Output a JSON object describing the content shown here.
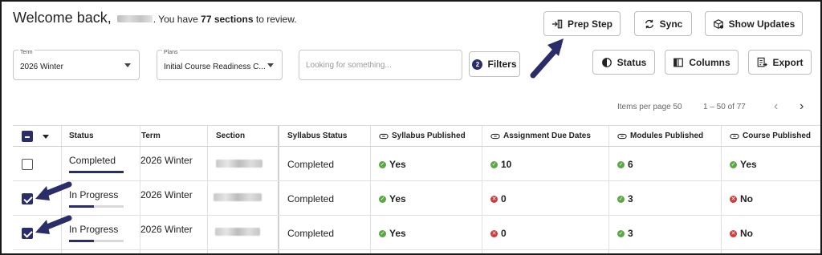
{
  "header": {
    "welcome_prefix": "Welcome back,",
    "welcome_suffix": ". You have",
    "count_text": "77 sections",
    "suffix2": "to review."
  },
  "toolbar": {
    "prep_step": "Prep Step",
    "sync": "Sync",
    "show_updates": "Show Updates",
    "status": "Status",
    "columns": "Columns",
    "export": "Export",
    "filters": "Filters",
    "filters_count": "2"
  },
  "filters": {
    "term_label": "Term",
    "term_value": "2026 Winter",
    "plans_label": "Plans",
    "plans_value": "Initial Course Readiness C...",
    "search_placeholder": "Looking for something..."
  },
  "pager": {
    "items_per_page": "Items per page 50",
    "range": "1 – 50 of 77"
  },
  "table": {
    "headers": {
      "status": "Status",
      "term": "Term",
      "section": "Section",
      "syllabus_status": "Syllabus Status",
      "syllabus_published": "Syllabus Published",
      "assignment_due_dates": "Assignment Due Dates",
      "modules_published": "Modules Published",
      "course_published": "Course Published"
    },
    "rows": [
      {
        "checked": false,
        "status": "Completed",
        "progress": 1.0,
        "term": "2026 Winter",
        "syllabus_status": "Completed",
        "syllabus_published": "Yes",
        "syllabus_published_ok": true,
        "assignment_due_dates": "10",
        "assignment_ok": true,
        "modules_published": "6",
        "modules_ok": true,
        "course_published": "Yes",
        "course_ok": true
      },
      {
        "checked": true,
        "status": "In Progress",
        "progress": 0.45,
        "term": "2026 Winter",
        "syllabus_status": "Completed",
        "syllabus_published": "Yes",
        "syllabus_published_ok": true,
        "assignment_due_dates": "0",
        "assignment_ok": false,
        "modules_published": "3",
        "modules_ok": true,
        "course_published": "No",
        "course_ok": false
      },
      {
        "checked": true,
        "status": "In Progress",
        "progress": 0.45,
        "term": "2026 Winter",
        "syllabus_status": "Completed",
        "syllabus_published": "Yes",
        "syllabus_published_ok": true,
        "assignment_due_dates": "0",
        "assignment_ok": false,
        "modules_published": "3",
        "modules_ok": true,
        "course_published": "No",
        "course_ok": false
      }
    ]
  },
  "colors": {
    "accent": "#2b2d6a",
    "ok": "#5aa844",
    "bad": "#d23b3b",
    "annotation_arrow": "#2b2d6a"
  }
}
